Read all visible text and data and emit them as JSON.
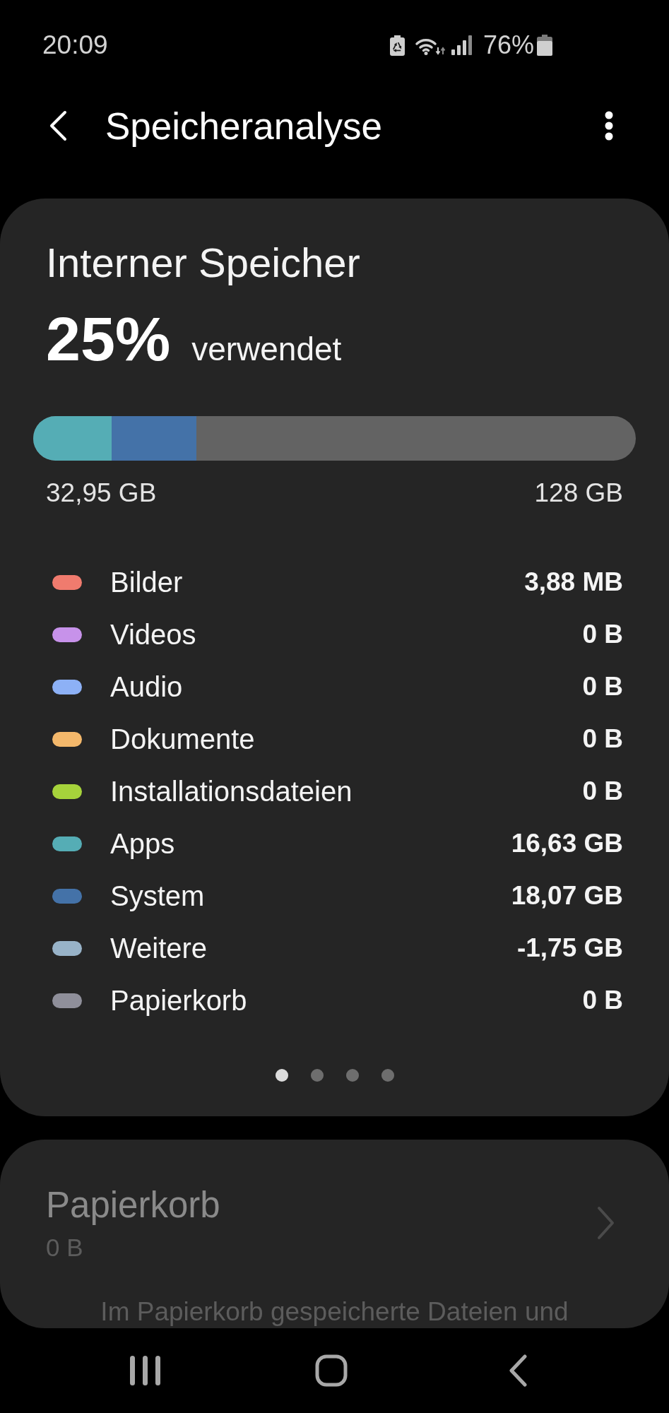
{
  "status_bar": {
    "time": "20:09",
    "battery": "76%"
  },
  "header": {
    "title": "Speicheranalyse"
  },
  "storage_card": {
    "title": "Interner Speicher",
    "percent": "25%",
    "percent_label": "verwendet",
    "usage_bar": {
      "segments": [
        {
          "color": "#55adb5",
          "level": 0.13
        },
        {
          "color": "#4472a8",
          "level": 0.141
        }
      ]
    },
    "used": "32,95 GB",
    "total": "128 GB",
    "categories": [
      {
        "name": "Bilder",
        "size": "3,88 MB",
        "color": "#f07b6e"
      },
      {
        "name": "Videos",
        "size": "0 B",
        "color": "#c792ea"
      },
      {
        "name": "Audio",
        "size": "0 B",
        "color": "#8db1f6"
      },
      {
        "name": "Dokumente",
        "size": "0 B",
        "color": "#f4b86b"
      },
      {
        "name": "Installationsdateien",
        "size": "0 B",
        "color": "#a6d33b"
      },
      {
        "name": "Apps",
        "size": "16,63 GB",
        "color": "#55adb5"
      },
      {
        "name": "System",
        "size": "18,07 GB",
        "color": "#4472a8"
      },
      {
        "name": "Weitere",
        "size": "-1,75 GB",
        "color": "#98b3c8"
      },
      {
        "name": "Papierkorb",
        "size": "0 B",
        "color": "#8f8f9a"
      }
    ],
    "pages": [
      {
        "selected": true
      },
      {
        "selected": false
      },
      {
        "selected": false
      },
      {
        "selected": false
      }
    ]
  },
  "trash_card": {
    "title": "Papierkorb",
    "size": "0 B",
    "description": "Im Papierkorb gespeicherte Dateien und",
    "disabled": true
  }
}
